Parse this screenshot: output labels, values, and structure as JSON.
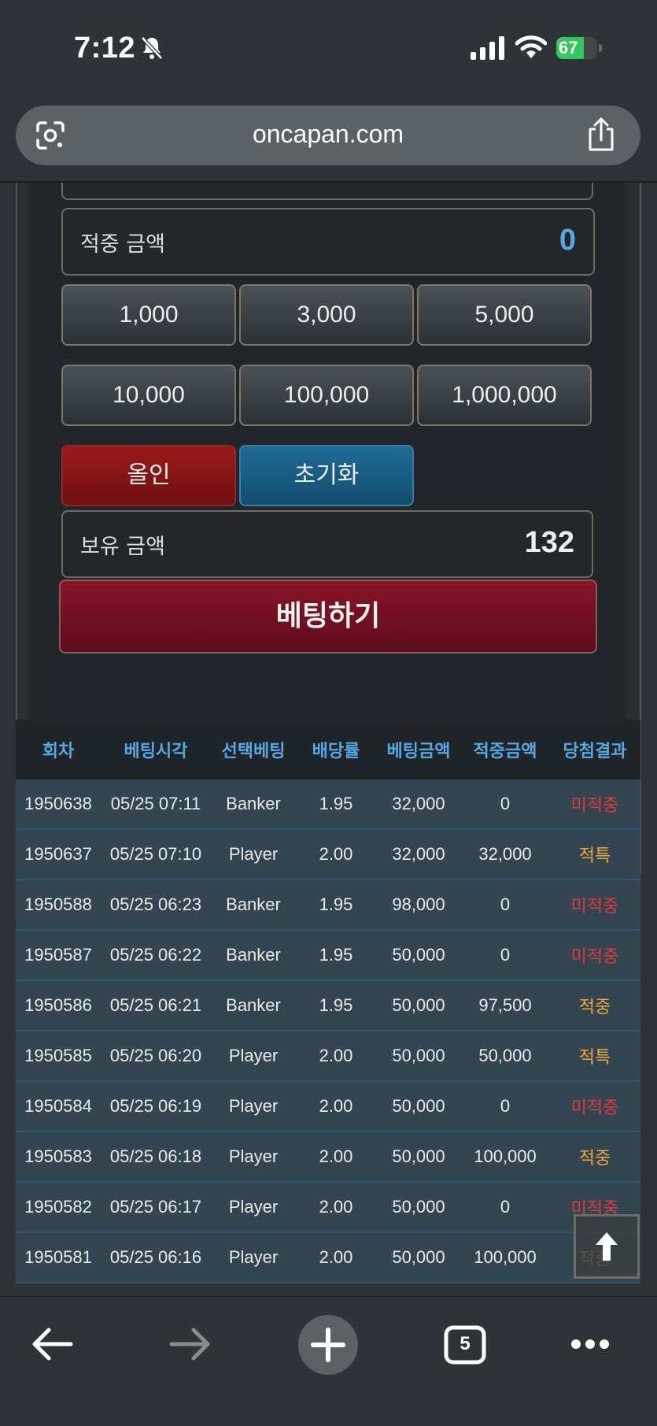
{
  "status": {
    "time": "7:12",
    "battery": "67",
    "battery_fraction": 0.67
  },
  "browser": {
    "url": "oncapan.com",
    "tab_count": "5"
  },
  "form": {
    "win_amount_label": "적중 금액",
    "win_amount_value": "0",
    "chips": [
      "1,000",
      "3,000",
      "5,000",
      "10,000",
      "100,000",
      "1,000,000"
    ],
    "allin_label": "올인",
    "reset_label": "초기화",
    "balance_label": "보유 금액",
    "balance_value": "132",
    "bet_label": "베팅하기"
  },
  "table": {
    "headers": [
      "회차",
      "베팅시각",
      "선택베팅",
      "배당률",
      "베팅금액",
      "적중금액",
      "당첨결과"
    ],
    "rows": [
      [
        "1950638",
        "05/25 07:11",
        "Banker",
        "1.95",
        "32,000",
        "0",
        "미적중"
      ],
      [
        "1950637",
        "05/25 07:10",
        "Player",
        "2.00",
        "32,000",
        "32,000",
        "적특"
      ],
      [
        "1950588",
        "05/25 06:23",
        "Banker",
        "1.95",
        "98,000",
        "0",
        "미적중"
      ],
      [
        "1950587",
        "05/25 06:22",
        "Banker",
        "1.95",
        "50,000",
        "0",
        "미적중"
      ],
      [
        "1950586",
        "05/25 06:21",
        "Banker",
        "1.95",
        "50,000",
        "97,500",
        "적중"
      ],
      [
        "1950585",
        "05/25 06:20",
        "Player",
        "2.00",
        "50,000",
        "50,000",
        "적특"
      ],
      [
        "1950584",
        "05/25 06:19",
        "Player",
        "2.00",
        "50,000",
        "0",
        "미적중"
      ],
      [
        "1950583",
        "05/25 06:18",
        "Player",
        "2.00",
        "50,000",
        "100,000",
        "적중"
      ],
      [
        "1950582",
        "05/25 06:17",
        "Player",
        "2.00",
        "50,000",
        "0",
        "미적중"
      ],
      [
        "1950581",
        "05/25 06:16",
        "Player",
        "2.00",
        "50,000",
        "100,000",
        "적중"
      ]
    ]
  },
  "colors": {
    "miss": "#e0373d",
    "hit": "#e9a93d",
    "header": "#57a7e3",
    "win_value": "#57a7e3"
  }
}
